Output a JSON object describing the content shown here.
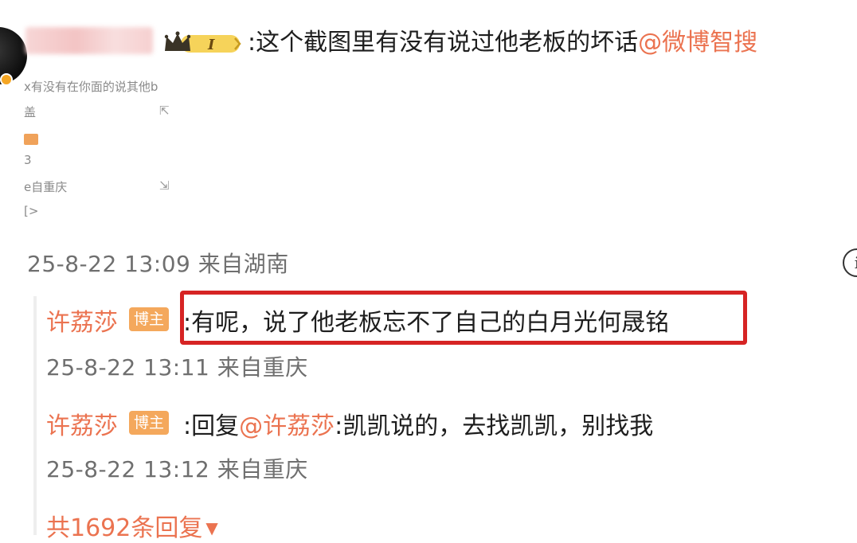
{
  "main_comment": {
    "text": ":这个截图里有没有说过他老板的坏话",
    "mention": "@微博智搜",
    "badge_level": "I",
    "timestamp": "25-8-22 13:09 来自湖南"
  },
  "embedded_fragments": {
    "line1": "x有没有在你面的说其他b",
    "line2": "盖",
    "line3": "3",
    "line4": "e自重庆",
    "line5": "[>"
  },
  "replies": [
    {
      "author": "许荔莎",
      "badge": "博主",
      "text": ":有呢，说了他老板忘不了自己的白月光何晟铭",
      "timestamp": "25-8-22 13:11 来自重庆"
    },
    {
      "author": "许荔莎",
      "badge": "博主",
      "prefix": ":回复",
      "mention": "@许荔莎",
      "text": ":凯凯说的，去找凯凯，别找我",
      "timestamp": "25-8-22 13:12 来自重庆"
    }
  ],
  "more_replies": "共1692条回复",
  "colors": {
    "accent": "#eb7350",
    "highlight": "#d62424",
    "badge": "#f4a85c"
  }
}
